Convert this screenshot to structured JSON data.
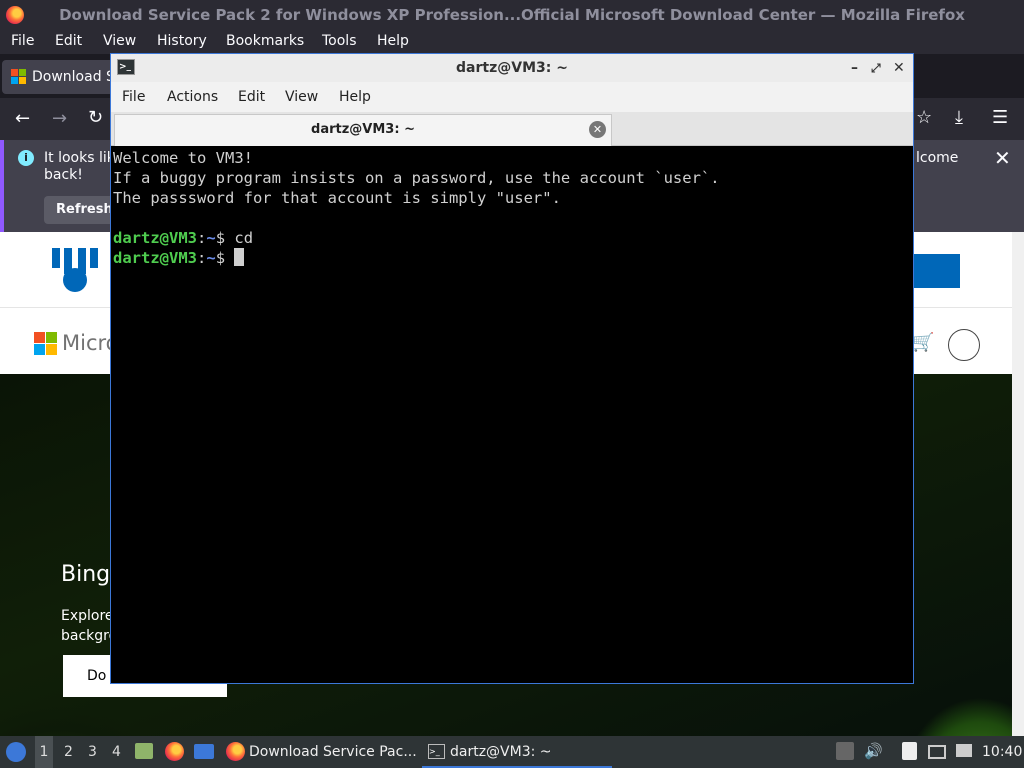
{
  "firefox": {
    "title": "Download Service Pack 2 for Windows XP Profession...Official Microsoft Download Center — Mozilla Firefox",
    "menu": [
      "File",
      "Edit",
      "View",
      "History",
      "Bookmarks",
      "Tools",
      "Help"
    ],
    "tab_label": "Download S",
    "notice_text_left": "It looks lik",
    "notice_text_left2": "back!",
    "notice_text_right": "lcome",
    "notice_button": "Refresh"
  },
  "webpage": {
    "brand_partial": "Micro",
    "hero_title": "Bing",
    "hero_text_1": "Explore",
    "hero_text_2": "backgro",
    "hero_button": "Do"
  },
  "terminal": {
    "title": "dartz@VM3: ~",
    "menu": [
      "File",
      "Actions",
      "Edit",
      "View",
      "Help"
    ],
    "tab_label": "dartz@VM3: ~",
    "lines": [
      "Welcome to VM3!",
      "If a buggy program insists on a password, use the account `user`.",
      "The passsword for that account is simply \"user\"."
    ],
    "prompt_user": "dartz@VM3",
    "prompt_sep": ":",
    "prompt_path": "~",
    "prompt_symbol": "$ ",
    "command_1": "cd"
  },
  "taskbar": {
    "workspaces": [
      "1",
      "2",
      "3",
      "4"
    ],
    "firefox_task": "Download Service Pac...",
    "terminal_task": "dartz@VM3: ~",
    "clock": "10:40"
  }
}
